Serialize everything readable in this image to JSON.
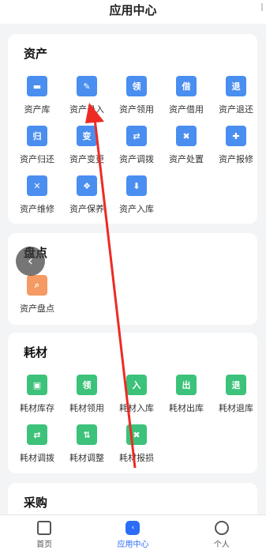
{
  "header": {
    "title": "应用中心"
  },
  "sections": [
    {
      "title": "资产",
      "items": [
        {
          "label": "资产库",
          "icon": "asset-library-icon",
          "glyph": "▬",
          "color": "blue"
        },
        {
          "label": "资产录入",
          "icon": "asset-entry-pen-icon",
          "glyph": "✎",
          "color": "blue"
        },
        {
          "label": "资产领用",
          "icon": "asset-receive-icon",
          "glyph": "领",
          "color": "blue"
        },
        {
          "label": "资产借用",
          "icon": "asset-borrow-icon",
          "glyph": "借",
          "color": "blue"
        },
        {
          "label": "资产退还",
          "icon": "asset-return-icon",
          "glyph": "退",
          "color": "blue"
        },
        {
          "label": "资产归还",
          "icon": "asset-giveback-icon",
          "glyph": "归",
          "color": "blue"
        },
        {
          "label": "资产变更",
          "icon": "asset-change-icon",
          "glyph": "变",
          "color": "blue"
        },
        {
          "label": "资产调拨",
          "icon": "asset-transfer-icon",
          "glyph": "⇄",
          "color": "blue"
        },
        {
          "label": "资产处置",
          "icon": "asset-dispose-trash-icon",
          "glyph": "✖",
          "color": "blue"
        },
        {
          "label": "资产报修",
          "icon": "asset-repair-toolbox-icon",
          "glyph": "✚",
          "color": "blue"
        },
        {
          "label": "资产维修",
          "icon": "asset-maintain-wrench-icon",
          "glyph": "✕",
          "color": "blue"
        },
        {
          "label": "资产保养",
          "icon": "asset-care-monitor-icon",
          "glyph": "❖",
          "color": "blue"
        },
        {
          "label": "资产入库",
          "icon": "asset-stock-in-icon",
          "glyph": "⬇",
          "color": "blue"
        }
      ]
    },
    {
      "title": "盘点",
      "items": [
        {
          "label": "资产盘点",
          "icon": "inventory-check-icon",
          "glyph": "⌕",
          "color": "orange"
        }
      ]
    },
    {
      "title": "耗材",
      "items": [
        {
          "label": "耗材库存",
          "icon": "consumable-stock-icon",
          "glyph": "▣",
          "color": "green"
        },
        {
          "label": "耗材领用",
          "icon": "consumable-receive-icon",
          "glyph": "领",
          "color": "green"
        },
        {
          "label": "耗材入库",
          "icon": "consumable-in-icon",
          "glyph": "入",
          "color": "green"
        },
        {
          "label": "耗材出库",
          "icon": "consumable-out-icon",
          "glyph": "出",
          "color": "green"
        },
        {
          "label": "耗材退库",
          "icon": "consumable-return-icon",
          "glyph": "退",
          "color": "green"
        },
        {
          "label": "耗材调拨",
          "icon": "consumable-transfer-icon",
          "glyph": "⇄",
          "color": "green"
        },
        {
          "label": "耗材调整",
          "icon": "consumable-adjust-icon",
          "glyph": "⇅",
          "color": "green"
        },
        {
          "label": "耗材报损",
          "icon": "consumable-loss-icon",
          "glyph": "✖",
          "color": "green"
        }
      ]
    },
    {
      "title": "采购",
      "items": []
    }
  ],
  "tabbar": [
    {
      "label": "首页",
      "icon": "home-icon",
      "active": false
    },
    {
      "label": "应用中心",
      "icon": "app-center-icon",
      "active": true
    },
    {
      "label": "个人",
      "icon": "person-icon",
      "active": false
    }
  ],
  "colors": {
    "accent": "#2d6cf6",
    "asset_blue": "#4a8ef0",
    "consumable_green": "#3cc27a",
    "inventory_orange": "#f59a62",
    "annotation_red": "#ee2a24"
  }
}
